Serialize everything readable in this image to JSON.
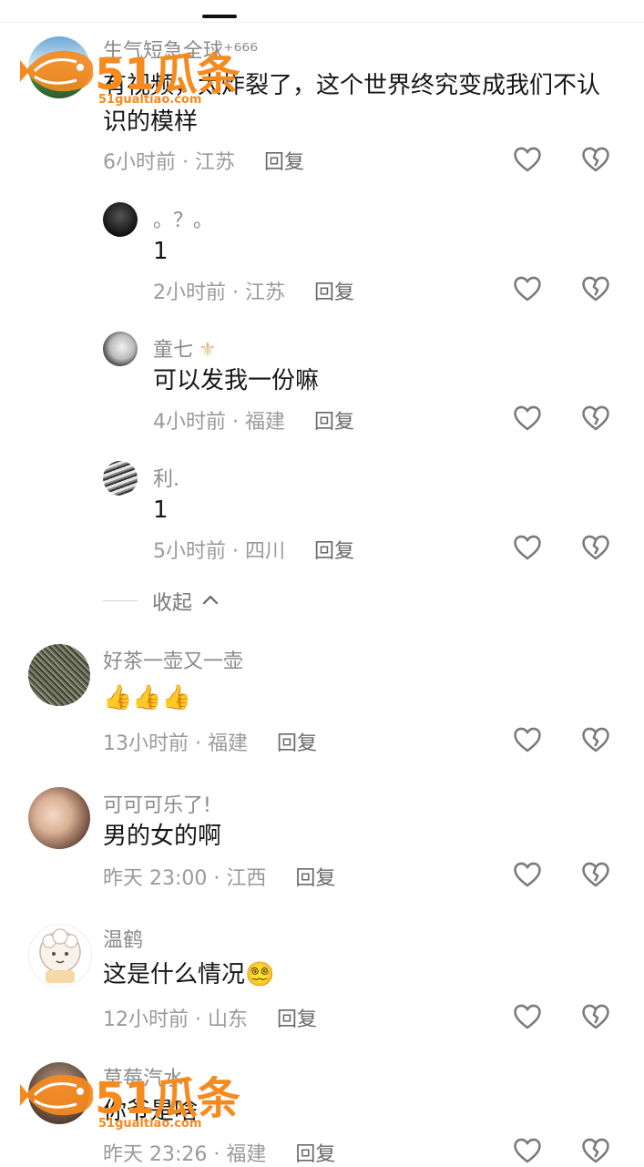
{
  "comments": [
    {
      "username": "生气短急全球⁺⁶⁶⁶",
      "text": "有视频，太炸裂了，这个世界终究变成我们不认识的模样",
      "time": "6小时前",
      "location": "江苏",
      "reply": "回复"
    },
    {
      "username": "。？。",
      "text": "1",
      "time": "2小时前",
      "location": "江苏",
      "reply": "回复"
    },
    {
      "username": "童七",
      "text": "可以发我一份嘛",
      "time": "4小时前",
      "location": "福建",
      "reply": "回复"
    },
    {
      "username": "利.",
      "text": "1",
      "time": "5小时前",
      "location": "四川",
      "reply": "回复"
    },
    {
      "username": "好茶一壶又一壶",
      "text": "👍👍👍",
      "time": "13小时前",
      "location": "福建",
      "reply": "回复"
    },
    {
      "username": "可可可乐了!",
      "text": "男的女的啊",
      "time": "昨天 23:00",
      "location": "江西",
      "reply": "回复"
    },
    {
      "username": "温鹤",
      "text": "这是什么情况😵‍💫",
      "time": "12小时前",
      "location": "山东",
      "reply": "回复"
    },
    {
      "username": "草莓汽水",
      "text": "你爷是啥",
      "time": "昨天 23:26",
      "location": "福建",
      "reply": "回复"
    }
  ],
  "collapse_label": "收起",
  "separator": " · ",
  "watermark": {
    "text": "51瓜条",
    "url": "51gualtiao.com"
  },
  "icons": {
    "like": "heart-outline-icon",
    "dislike": "broken-heart-icon",
    "collapse": "chevron-up-icon"
  },
  "colors": {
    "watermark": "#f58a1f",
    "meta": "#9a9a9a",
    "username": "#8a8a8a"
  }
}
